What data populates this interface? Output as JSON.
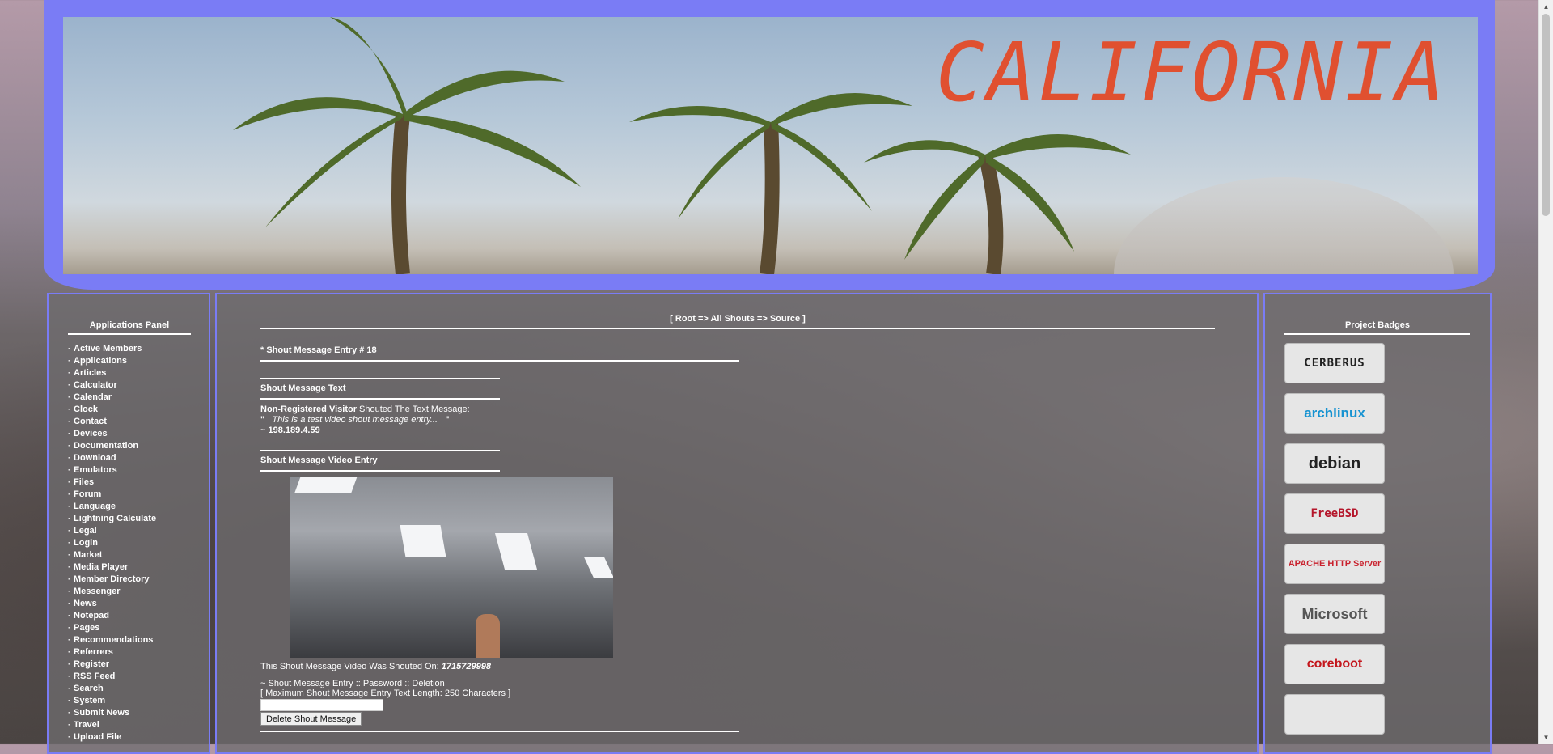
{
  "banner": {
    "title": "CALIFORNIA"
  },
  "left_panel": {
    "title": "Applications Panel",
    "items": [
      {
        "label": "Active Members"
      },
      {
        "label": "Applications"
      },
      {
        "label": "Articles"
      },
      {
        "label": "Calculator"
      },
      {
        "label": "Calendar"
      },
      {
        "label": "Clock"
      },
      {
        "label": "Contact"
      },
      {
        "label": "Devices"
      },
      {
        "label": "Documentation"
      },
      {
        "label": "Download"
      },
      {
        "label": "Emulators"
      },
      {
        "label": "Files"
      },
      {
        "label": "Forum"
      },
      {
        "label": "Language"
      },
      {
        "label": "Lightning Calculate"
      },
      {
        "label": "Legal"
      },
      {
        "label": "Login"
      },
      {
        "label": "Market"
      },
      {
        "label": "Media Player"
      },
      {
        "label": "Member Directory"
      },
      {
        "label": "Messenger"
      },
      {
        "label": "News"
      },
      {
        "label": "Notepad"
      },
      {
        "label": "Pages"
      },
      {
        "label": "Recommendations"
      },
      {
        "label": "Referrers"
      },
      {
        "label": "Register"
      },
      {
        "label": "RSS Feed"
      },
      {
        "label": "Search"
      },
      {
        "label": "System"
      },
      {
        "label": "Submit News"
      },
      {
        "label": "Travel"
      },
      {
        "label": "Upload File"
      }
    ]
  },
  "main": {
    "breadcrumb": "[ Root => All Shouts => Source ]",
    "entry_heading": "* Shout Message Entry # 18",
    "text_section_title": "Shout Message Text",
    "shouter": "Non-Registered Visitor",
    "shouted_text_label": " Shouted The Text Message:",
    "open_quote": "\"",
    "message": "This is a test video shout message entry...",
    "close_quote": "\"",
    "ip": "~ 198.189.4.59",
    "video_section_title": "Shout Message Video Entry",
    "shouted_on_label": "This Shout Message Video Was Shouted On: ",
    "shouted_on_value": "1715729998",
    "deletion_label": "~ Shout Message Entry :: Password :: Deletion",
    "max_length": "[ Maximum Shout Message Entry Text Length: 250 Characters ]",
    "password_value": "",
    "delete_button": "Delete Shout Message"
  },
  "right_panel": {
    "title": "Project Badges",
    "badges": [
      {
        "label": "CERBERUS",
        "icon": "cerberus-logo"
      },
      {
        "label": "archlinux",
        "icon": "archlinux-logo"
      },
      {
        "label": "debian",
        "icon": "debian-logo"
      },
      {
        "label": "FreeBSD",
        "icon": "freebsd-logo"
      },
      {
        "label": "APACHE HTTP Server",
        "icon": "apache-logo"
      },
      {
        "label": "Microsoft",
        "icon": "microsoft-logo"
      },
      {
        "label": "coreboot",
        "icon": "coreboot-logo"
      },
      {
        "label": "",
        "icon": "dots-arrow-logo"
      }
    ]
  },
  "colors": {
    "frame": "#7a7cf5",
    "banner_text": "#e05030"
  }
}
